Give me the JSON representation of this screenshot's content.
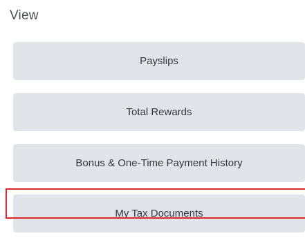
{
  "section": {
    "title": "View"
  },
  "buttons": [
    {
      "label": "Payslips"
    },
    {
      "label": "Total Rewards"
    },
    {
      "label": "Bonus & One-Time Payment History"
    },
    {
      "label": "My Tax Documents"
    }
  ],
  "colors": {
    "button_bg": "#e1e5e9",
    "highlight": "#d9252c",
    "title_text": "#4a4f55",
    "button_text": "#33383e"
  }
}
